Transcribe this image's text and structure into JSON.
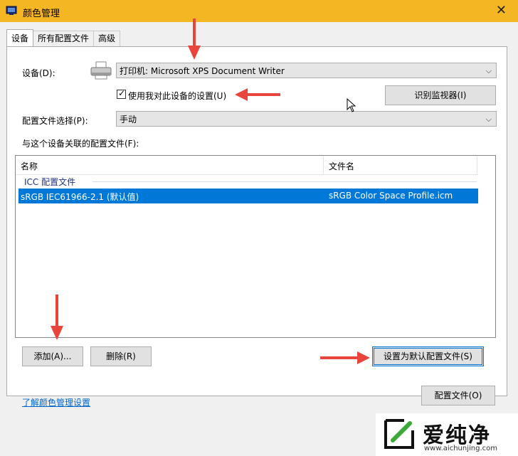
{
  "window": {
    "title": "颜色管理"
  },
  "tabs": [
    {
      "label": "设备"
    },
    {
      "label": "所有配置文件"
    },
    {
      "label": "高级"
    }
  ],
  "device": {
    "label": "设备(D):",
    "value": "打印机: Microsoft XPS Document Writer",
    "use_my_settings_label": "使用我对此设备的设置(U)",
    "use_my_settings_checked": true,
    "identify_monitors_label": "识别监视器(I)"
  },
  "profile_selection": {
    "label": "配置文件选择(P):",
    "value": "手动"
  },
  "associated": {
    "label": "与这个设备关联的配置文件(F):",
    "columns": [
      "名称",
      "文件名"
    ],
    "group": "ICC 配置文件",
    "rows": [
      {
        "name": "sRGB IEC61966-2.1 (默认值)",
        "file": "sRGB Color Space Profile.icm"
      }
    ]
  },
  "buttons": {
    "add": "添加(A)...",
    "remove": "删除(R)",
    "set_default": "设置为默认配置文件(S)",
    "profiles": "配置文件(O)"
  },
  "learn_link": "了解颜色管理设置",
  "watermark": {
    "brand": "爱纯净",
    "url": "www.aichunjing.com"
  },
  "colors": {
    "titlebar": "#f5b624",
    "selection": "#0078d7",
    "annotation_arrow": "#e8453c",
    "watermark_green": "#3aa935"
  }
}
